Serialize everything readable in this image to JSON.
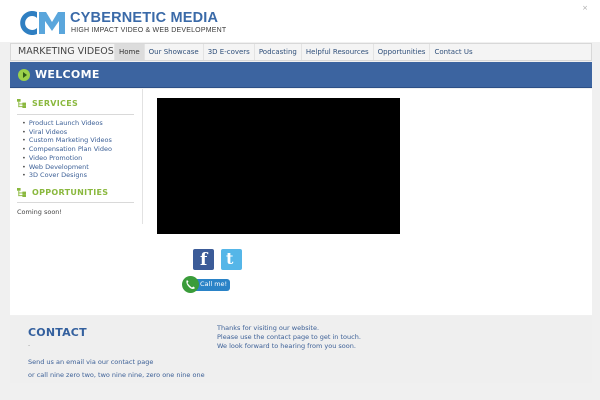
{
  "header": {
    "logo_title": "CYBERNETIC MEDIA",
    "logo_subtitle": "HIGH IMPACT VIDEO & WEB DEVELOPMENT",
    "close_label": "×"
  },
  "nav": {
    "brand": "MARKETING VIDEOS",
    "items": [
      {
        "label": "Home",
        "active": true
      },
      {
        "label": "Our Showcase"
      },
      {
        "label": "3D E-covers"
      },
      {
        "label": "Podcasting"
      },
      {
        "label": "Helpful Resources"
      },
      {
        "label": "Opportunities"
      },
      {
        "label": "Contact Us"
      }
    ]
  },
  "welcome": {
    "title": "WELCOME"
  },
  "sidebar": {
    "services_title": "SERVICES",
    "services": [
      "Product Launch Videos",
      "Viral Videos",
      "Custom Marketing Videos",
      "Compensation Plan Video",
      "Video Promotion",
      "Web Development",
      "3D Cover Designs"
    ],
    "opportunities_title": "OPPORTUNITIES",
    "opportunities_text": "Coming soon!"
  },
  "social": {
    "facebook_glyph": "f",
    "twitter_glyph": "t",
    "call_label": "Call me!"
  },
  "footer": {
    "contact_title": "CONTACT",
    "contact_dash": "-",
    "contact_line1": "Send us an email via our contact page",
    "contact_line2": "or call nine zero two, two nine nine, zero one nine one",
    "thanks": [
      "Thanks for visiting our website.",
      "Please use the contact page to get in touch.",
      "We look forward to hearing from you soon."
    ]
  },
  "colors": {
    "brand_blue": "#3c64a0",
    "accent_green": "#8ab83e",
    "link_blue": "#3b5f96"
  }
}
